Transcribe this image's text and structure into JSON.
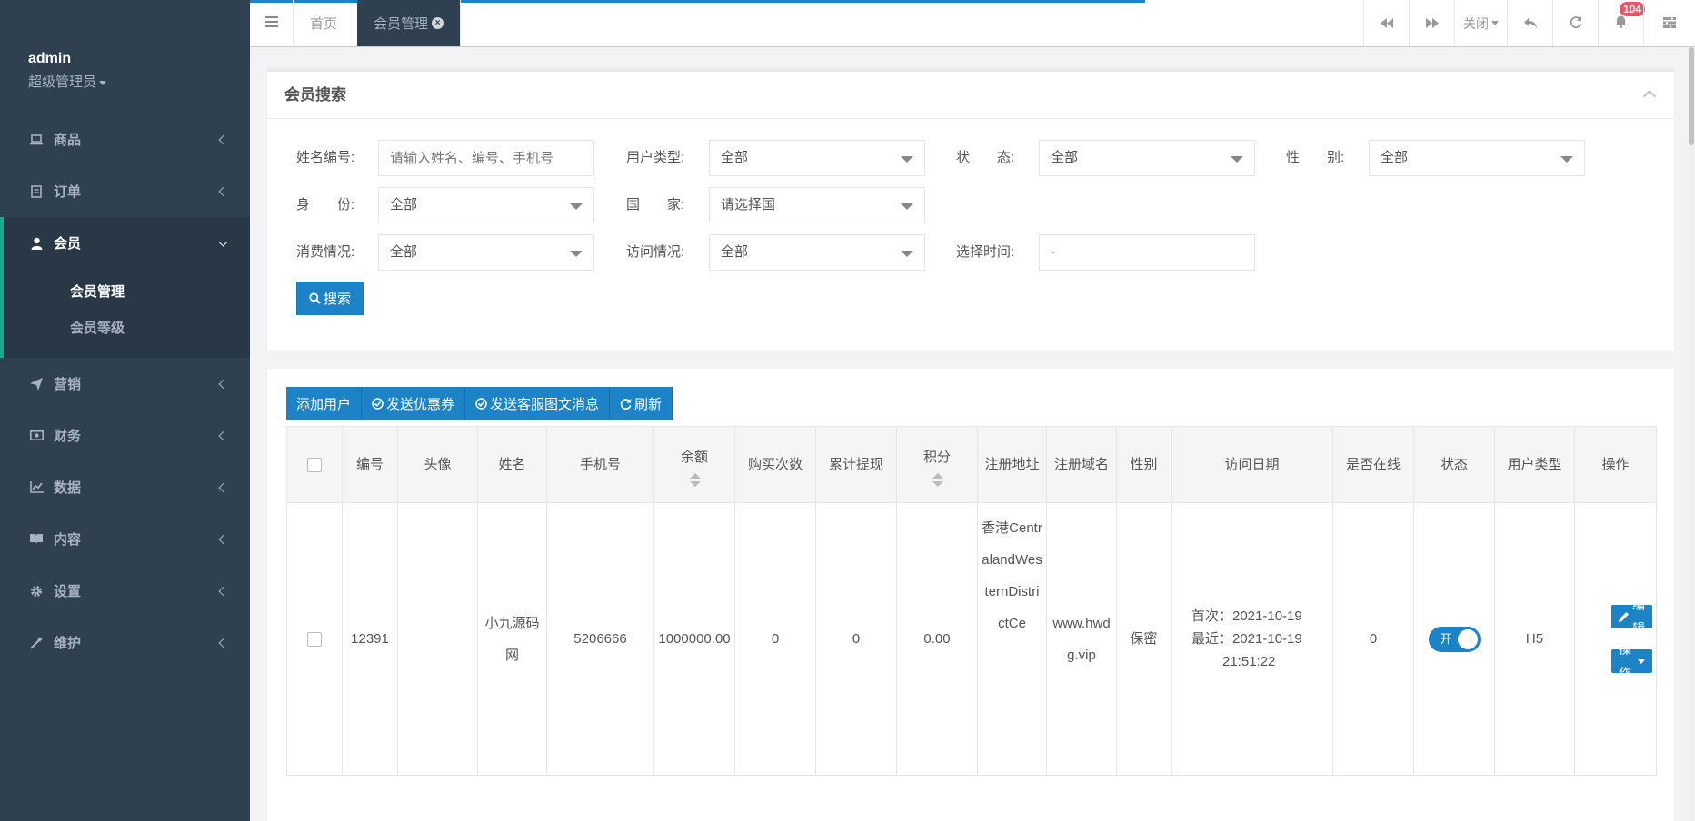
{
  "sidebar": {
    "profile": {
      "name": "admin",
      "role": "超级管理员"
    },
    "items": [
      {
        "label": "商品",
        "icon": "laptop-icon"
      },
      {
        "label": "订单",
        "icon": "list-icon"
      },
      {
        "label": "会员",
        "icon": "user-icon",
        "active": true
      },
      {
        "label": "营销",
        "icon": "send-icon"
      },
      {
        "label": "财务",
        "icon": "money-icon"
      },
      {
        "label": "数据",
        "icon": "line-chart-icon"
      },
      {
        "label": "内容",
        "icon": "book-icon"
      },
      {
        "label": "设置",
        "icon": "gear-icon"
      },
      {
        "label": "维护",
        "icon": "magic-icon"
      }
    ],
    "sub_items": [
      {
        "label": "会员管理",
        "current": true
      },
      {
        "label": "会员等级"
      }
    ]
  },
  "topbar": {
    "tabs": [
      {
        "label": "首页"
      },
      {
        "label": "会员管理",
        "active": true
      }
    ],
    "close_label": "关闭",
    "notification_count": "104"
  },
  "search": {
    "title": "会员搜索",
    "fields": {
      "name_label": "姓名编号:",
      "name_placeholder": "请输入姓名、编号、手机号",
      "user_type_label": "用户类型:",
      "user_type_value": "全部",
      "status_label": "状　　态:",
      "status_value": "全部",
      "gender_label": "性　　别:",
      "gender_value": "全部",
      "identity_label": "身　　份:",
      "identity_value": "全部",
      "country_label": "国　　家:",
      "country_value": "请选择国",
      "consume_label": "消费情况:",
      "consume_value": "全部",
      "visit_label": "访问情况:",
      "visit_value": "全部",
      "time_label": "选择时间:",
      "time_value": "-"
    },
    "button": "搜索"
  },
  "toolbar": {
    "add_user": "添加用户",
    "send_coupon": "发送优惠券",
    "send_message": "发送客服图文消息",
    "refresh": "刷新"
  },
  "table": {
    "headers": {
      "id": "编号",
      "avatar": "头像",
      "name": "姓名",
      "phone": "手机号",
      "balance": "余额",
      "purchase_count": "购买次数",
      "total_withdraw": "累计提现",
      "points": "积分",
      "reg_address": "注册地址",
      "reg_domain": "注册域名",
      "gender": "性别",
      "visit_date": "访问日期",
      "online": "是否在线",
      "status": "状态",
      "user_type": "用户类型",
      "actions": "操作"
    },
    "rows": [
      {
        "id": "12391",
        "name": "小九源码网",
        "phone": "5206666",
        "balance": "1000000.00",
        "purchase_count": "0",
        "total_withdraw": "0",
        "points": "0.00",
        "reg_address": "香港CentralandWesternDistrictCe",
        "reg_domain": "www.hwdg.vip",
        "gender": "保密",
        "visit_first": "首次：2021-10-19",
        "visit_last": "最近：2021-10-19",
        "visit_time": "21:51:22",
        "online": "0",
        "status_toggle": "开",
        "user_type": "H5",
        "edit_btn": "编辑",
        "ops_btn": "操作"
      }
    ]
  }
}
